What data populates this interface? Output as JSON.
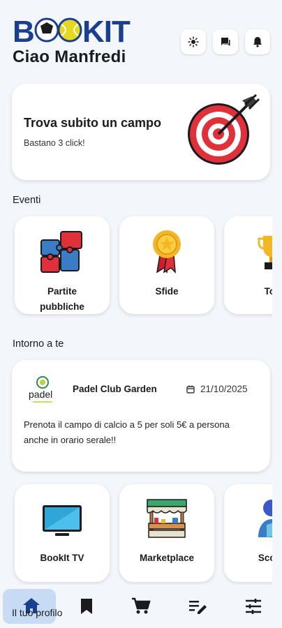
{
  "header": {
    "logo_text": "BOOKIT",
    "greeting": "Ciao Manfredi",
    "actions": [
      {
        "icon": "sun-icon"
      },
      {
        "icon": "chat-icon"
      },
      {
        "icon": "bell-icon"
      }
    ]
  },
  "hero": {
    "title": "Trova subito un campo",
    "subtitle": "Bastano 3 click!",
    "icon": "target-icon"
  },
  "events": {
    "title": "Eventi",
    "items": [
      {
        "label_line1": "Partite",
        "label_line2": "pubbliche",
        "icon": "puzzle-icon"
      },
      {
        "label": "Sfide",
        "icon": "medal-icon"
      },
      {
        "label": "Tor",
        "icon": "trophy-icon"
      }
    ]
  },
  "nearby": {
    "title": "Intorno a te",
    "card": {
      "logo_text": "padel",
      "club": "Padel Club Garden",
      "date": "21/10/2025",
      "body": "Prenota il campo di calcio a 5 per soli 5€ a persona anche in orario serale!!"
    }
  },
  "services": {
    "items": [
      {
        "label": "BookIt TV",
        "icon": "tv-icon"
      },
      {
        "label": "Marketplace",
        "icon": "market-stall-icon"
      },
      {
        "label": "Scopr",
        "icon": "discover-icon"
      }
    ]
  },
  "nav": {
    "profile_label": "Il tuo profilo",
    "items": [
      {
        "icon": "home-icon",
        "active": true
      },
      {
        "icon": "bookmark-icon"
      },
      {
        "icon": "cart-icon"
      },
      {
        "icon": "edit-list-icon"
      },
      {
        "icon": "sliders-icon"
      }
    ]
  },
  "colors": {
    "background": "#f3f6fb",
    "logo_blue": "#1b3f8f",
    "accent_red": "#e0313b",
    "active_nav": "#c7dcf4"
  }
}
